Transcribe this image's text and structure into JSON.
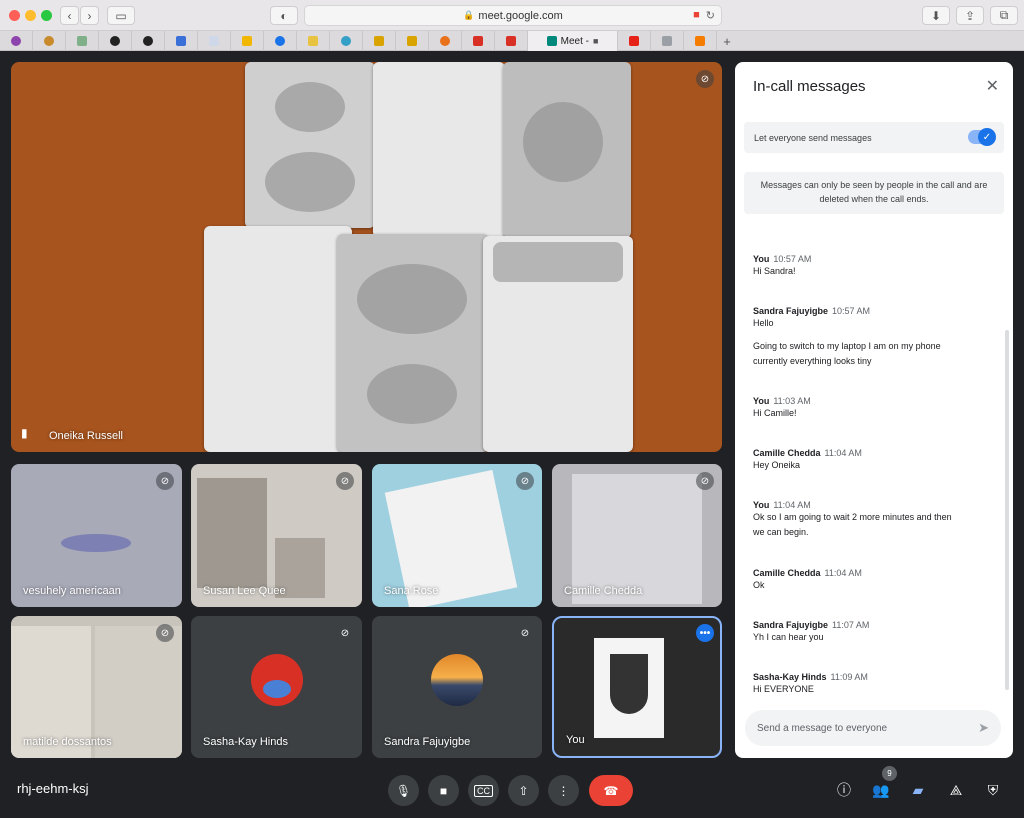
{
  "browser": {
    "url": "meet.google.com",
    "active_tab_label": "Meet -",
    "new_tab_label": "+"
  },
  "main_video": {
    "participant": "Oneika Russell",
    "pin_icon": "pin-icon",
    "muted_icon": "mic-off-icon"
  },
  "participants": [
    {
      "name": "vesuhely americaan"
    },
    {
      "name": "Susan Lee Quee"
    },
    {
      "name": "Sana Rose"
    },
    {
      "name": "Camille Chedda"
    },
    {
      "name": "matilde dossantos"
    },
    {
      "name": "Sasha-Kay Hinds"
    },
    {
      "name": "Sandra Fajuyigbe"
    },
    {
      "name": "You"
    }
  ],
  "chat": {
    "title": "In-call messages",
    "toggle_label": "Let everyone send messages",
    "notice": "Messages can only be seen by people in the call and are deleted when the call ends.",
    "input_placeholder": "Send a message to everyone",
    "messages": [
      {
        "sender": "You",
        "time": "10:57 AM",
        "lines": [
          "Hi Sandra!"
        ]
      },
      {
        "sender": "Sandra Fajuyigbe",
        "time": "10:57 AM",
        "lines": [
          "Hello",
          "",
          "Going to switch to my laptop I am on my phone",
          "currently everything looks tiny"
        ]
      },
      {
        "sender": "You",
        "time": "11:03 AM",
        "lines": [
          "Hi Camille!"
        ]
      },
      {
        "sender": "Camille Chedda",
        "time": "11:04 AM",
        "lines": [
          "Hey Oneika"
        ]
      },
      {
        "sender": "You",
        "time": "11:04 AM",
        "lines": [
          "Ok so I am going to wait 2 more minutes and then",
          "we can begin."
        ]
      },
      {
        "sender": "Camille Chedda",
        "time": "11:04 AM",
        "lines": [
          "Ok"
        ]
      },
      {
        "sender": "Sandra Fajuyigbe",
        "time": "11:07 AM",
        "lines": [
          "Yh I can hear you"
        ]
      },
      {
        "sender": "Sasha-Kay Hinds",
        "time": "11:09 AM",
        "lines": [
          "Hi EVERYONE"
        ]
      }
    ]
  },
  "toolbar": {
    "meeting_code": "rhj-eehm-ksj",
    "people_count": "9"
  },
  "colors": {
    "accent": "#1a73e8",
    "end_call": "#ea4335",
    "background": "#202124"
  }
}
